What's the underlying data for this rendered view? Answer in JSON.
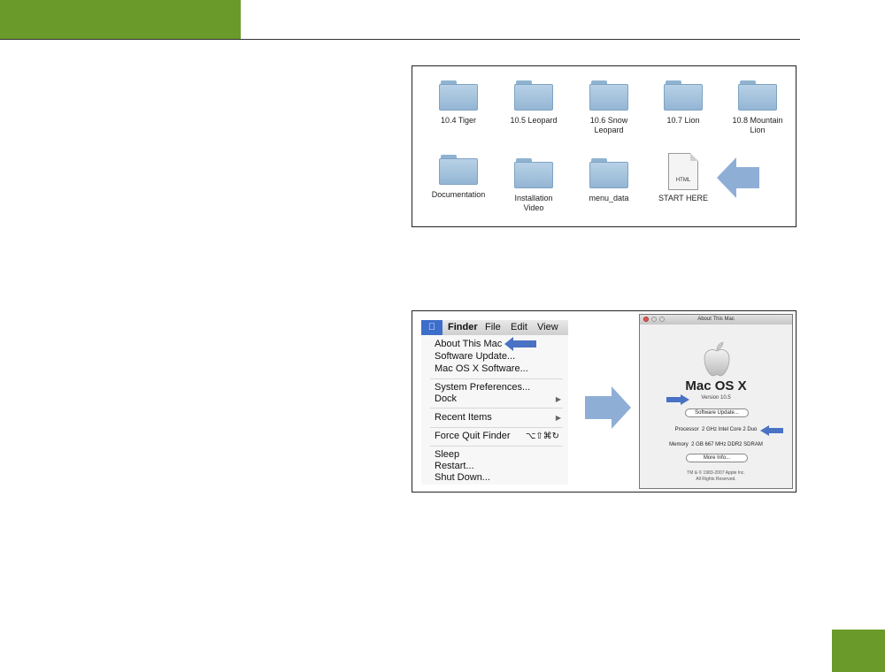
{
  "finder_window": {
    "items_row1": [
      "10.4 Tiger",
      "10.5 Leopard",
      "10.6 Snow Leopard",
      "10.7 Lion",
      "10.8 Mountain Lion"
    ],
    "items_row2": [
      "Documentation",
      "Installation Video",
      "menu_data"
    ],
    "html_file": {
      "label": "START HERE",
      "badge": "HTML"
    }
  },
  "apple_menu": {
    "menubar": {
      "app": "Finder",
      "items": [
        "File",
        "Edit",
        "View"
      ]
    },
    "items": [
      "About This Mac",
      "Software Update...",
      "Mac OS X Software...",
      "System Preferences...",
      "Dock",
      "Recent Items",
      "Force Quit Finder",
      "Sleep",
      "Restart...",
      "Shut Down..."
    ],
    "force_quit_shortcut": "⌥⇧⌘↻"
  },
  "about_window": {
    "title": "About This Mac",
    "os_name": "Mac OS X",
    "version": "Version 10.5",
    "software_update": "Software Update...",
    "processor_label": "Processor",
    "processor_value": "2 GHz Intel Core 2 Duo",
    "memory_label": "Memory",
    "memory_value": "2 GB 667 MHz DDR2 SDRAM",
    "more_info": "More Info...",
    "copyright": "TM & © 1983-2007 Apple Inc.",
    "rights": "All Rights Reserved."
  },
  "colors": {
    "accent_green": "#6a9a2a",
    "arrow_blue": "#4a72c4",
    "arrow_lightblue": "#8eaed6"
  }
}
